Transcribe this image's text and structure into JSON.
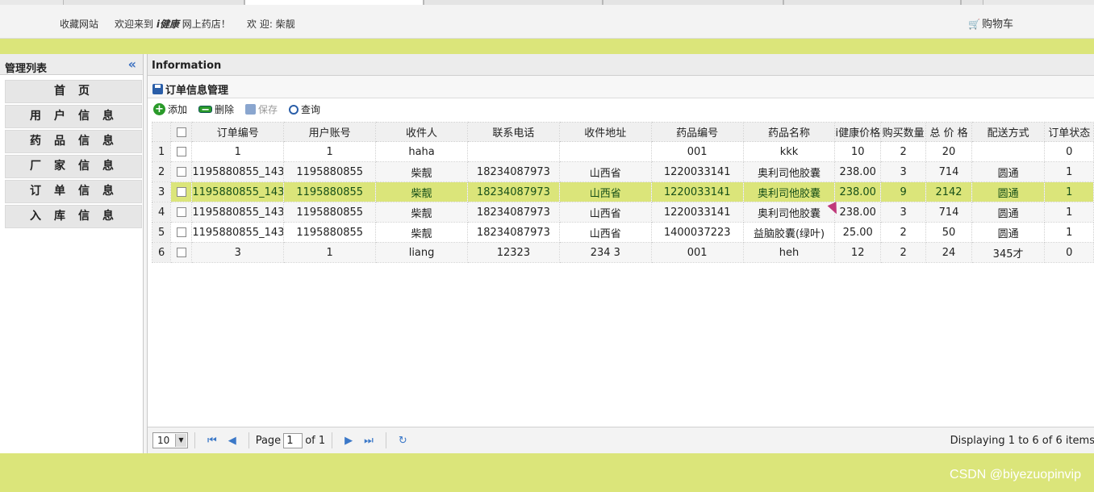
{
  "header": {
    "favorite": "收藏网站",
    "welcome_prefix": "欢迎来到",
    "brand": "i健康",
    "welcome_suffix": "网上药店！",
    "user_greeting": "欢 迎: 柴靓",
    "cart_label": "购物车"
  },
  "sidebar": {
    "title": "管理列表",
    "collapse_icon": "double-chevron-left-icon",
    "items": [
      {
        "label": "首页"
      },
      {
        "label": "用户信息"
      },
      {
        "label": "药品信息"
      },
      {
        "label": "厂家信息"
      },
      {
        "label": "订单信息"
      },
      {
        "label": "入库信息"
      }
    ]
  },
  "main": {
    "info_title": "Information",
    "panel_title": "订单信息管理",
    "toolbar": {
      "add": "添加",
      "delete": "删除",
      "save": "保存",
      "search": "查询"
    },
    "columns": [
      "订单编号",
      "用户账号",
      "收件人",
      "联系电话",
      "收件地址",
      "药品编号",
      "药品名称",
      "i健康价格",
      "购买数量",
      "总 价 格",
      "配送方式",
      "订单状态"
    ],
    "rows": [
      {
        "n": "1",
        "cells": [
          "1",
          "1",
          "haha",
          "",
          "",
          "001",
          "kkk",
          "10",
          "2",
          "20",
          "",
          "0"
        ]
      },
      {
        "n": "2",
        "cells": [
          "1195880855_143",
          "1195880855",
          "柴靓",
          "18234087973",
          "山西省",
          "1220033141",
          "奥利司他胶囊",
          "238.00",
          "3",
          "714",
          "圆通",
          "1"
        ]
      },
      {
        "n": "3",
        "cells": [
          "1195880855_143",
          "1195880855",
          "柴靓",
          "18234087973",
          "山西省",
          "1220033141",
          "奥利司他胶囊",
          "238.00",
          "9",
          "2142",
          "圆通",
          "1"
        ]
      },
      {
        "n": "4",
        "cells": [
          "1195880855_143",
          "1195880855",
          "柴靓",
          "18234087973",
          "山西省",
          "1220033141",
          "奥利司他胶囊",
          "238.00",
          "3",
          "714",
          "圆通",
          "1"
        ]
      },
      {
        "n": "5",
        "cells": [
          "1195880855_143",
          "1195880855",
          "柴靓",
          "18234087973",
          "山西省",
          "1400037223",
          "益脑胶囊(绿叶)",
          "25.00",
          "2",
          "50",
          "圆通",
          "1"
        ]
      },
      {
        "n": "6",
        "cells": [
          "3",
          "1",
          "liang",
          "12323",
          "234 3",
          "001",
          "heh",
          "12",
          "2",
          "24",
          "345才",
          "0"
        ]
      }
    ],
    "selected_row": 3
  },
  "pager": {
    "page_size": "10",
    "page_label": "Page",
    "page_value": "1",
    "of_label": "of 1",
    "display_info": "Displaying 1 to 6 of 6 items"
  },
  "watermark": "CSDN @biyezuopinvip",
  "colors": {
    "accent_green": "#dbe57a",
    "selected_text": "#174f17",
    "link_blue": "#3b78c8"
  }
}
